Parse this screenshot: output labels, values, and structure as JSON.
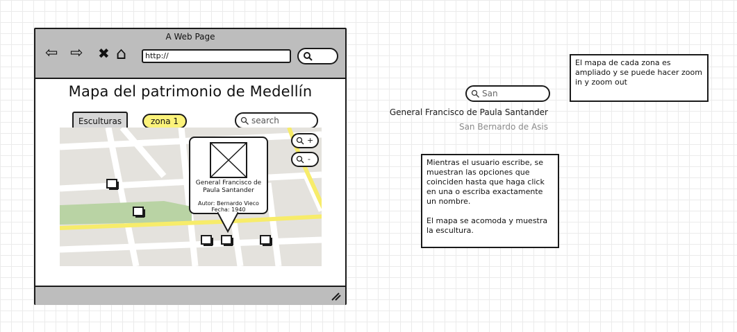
{
  "browser": {
    "title": "A Web Page",
    "url": "http://",
    "nav": {
      "back": "⇦",
      "forward": "⇨",
      "stop": "✖",
      "home": "⌂"
    }
  },
  "page": {
    "title": "Mapa del patrimonio de Medellín",
    "tab_label": "Esculturas",
    "zone_label": "zona 1",
    "search_placeholder": "search",
    "zoom_in": "+",
    "zoom_out": "-"
  },
  "popup": {
    "name": "General Francisco de Paula Santander",
    "author": "Autor: Bernardo Vieco",
    "date": "Fecha: 1940"
  },
  "autocomplete": {
    "input_value": "San",
    "options": [
      "General Francisco de Paula Santander",
      "San Bernardo de Asis"
    ]
  },
  "notes": {
    "zoom_note": "El mapa de cada zona es ampliado y se puede hacer zoom in y zoom out",
    "search_note_1": "Mientras el usuario escribe, se muestran las opciones que coinciden hasta que haga click en una o escriba exactamente un nombre.",
    "search_note_2": "El mapa se acomoda y muestra la escultura."
  },
  "colors": {
    "chrome": "#bdbdbd",
    "highlight": "#fbf27a",
    "map_bg": "#e4e2dd",
    "park": "#b9d3a4",
    "road_main": "#f7ec6a"
  },
  "icons": {
    "search": "magnifier-icon",
    "marker": "sculpture-marker-icon",
    "image": "image-placeholder-icon",
    "resize": "resize-grip-icon"
  }
}
